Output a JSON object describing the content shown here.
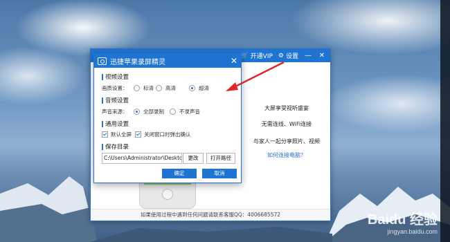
{
  "desktop": {
    "watermark_brand": "Baidu 经验",
    "watermark_url": "jingyan.baidu.com"
  },
  "main_window": {
    "titlebar": {
      "vip_label": "开通VIP",
      "settings_label": "设置",
      "minimize_glyph": "—",
      "close_glyph": "✕"
    },
    "promo": {
      "line1": "大屏享受视听盛宴",
      "line2": "无需连线、WiFi连接",
      "line3": "与家人一起分享照片、视频",
      "link": "如何连接电脑？"
    },
    "status": "如果使用过程中遇到任何问题请联系客服QQ：4006685572"
  },
  "settings_dialog": {
    "title": "迅捷苹果录屏精灵",
    "close_glyph": "✕",
    "video": {
      "heading": "视频设置",
      "quality_label": "画质设置：",
      "options": [
        "标清",
        "高清",
        "超清"
      ],
      "selected": "超清"
    },
    "audio": {
      "heading": "音频设置",
      "source_label": "声音来源：",
      "options": [
        "全部录制",
        "不录声音"
      ],
      "selected": "全部录制"
    },
    "general": {
      "heading": "通用设置",
      "default_fullscreen": "默认全屏",
      "default_fullscreen_checked": true,
      "close_confirm": "关闭窗口时弹出确认",
      "close_confirm_checked": true
    },
    "save": {
      "heading": "保存目录",
      "path": "C:\\Users\\Administrator\\Desktop\\",
      "change_label": "更改",
      "open_label": "打开路径"
    },
    "ok_label": "确定",
    "cancel_label": "取消"
  },
  "colors": {
    "accent": "#1f74d1",
    "annotation_arrow": "#e0262b"
  }
}
